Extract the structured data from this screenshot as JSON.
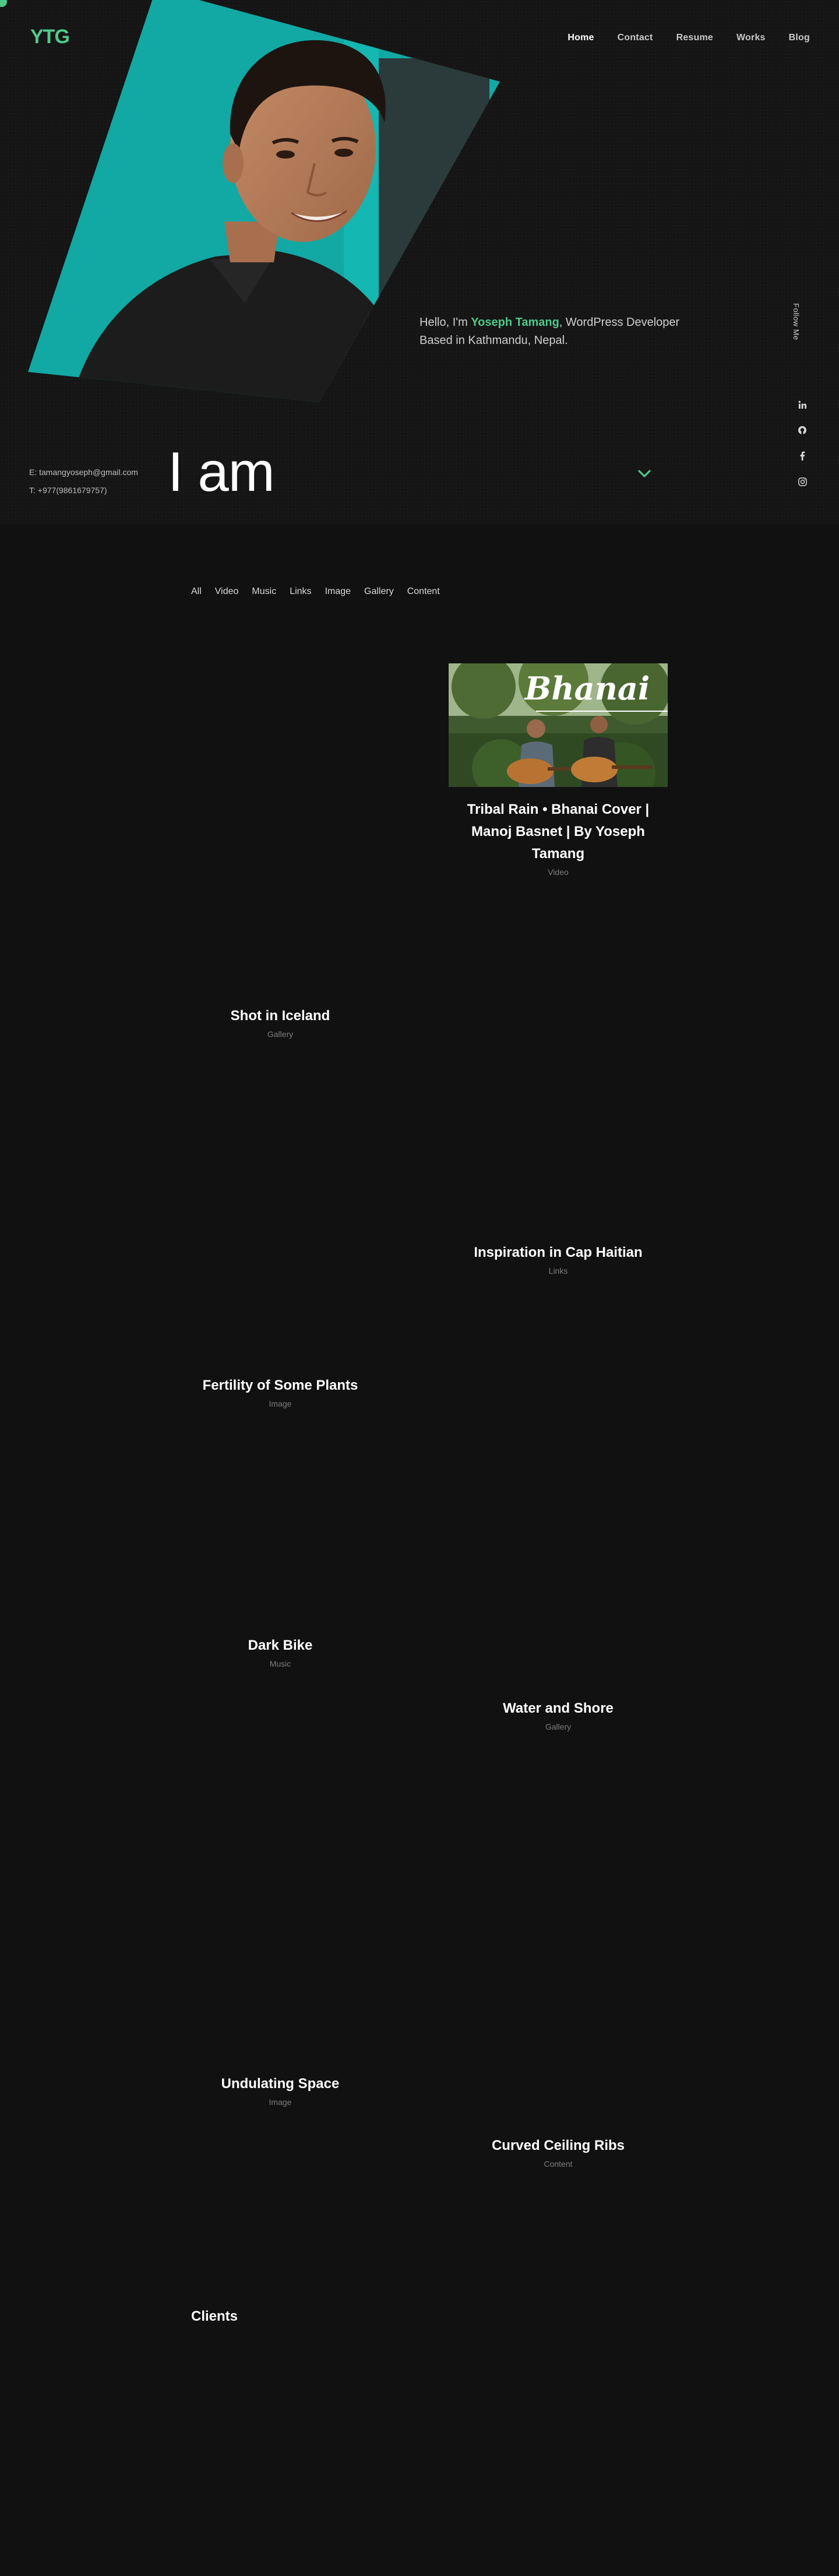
{
  "brand": {
    "logo_text": "YTG"
  },
  "nav": {
    "items": [
      {
        "label": "Home",
        "active": true
      },
      {
        "label": "Contact",
        "active": false
      },
      {
        "label": "Resume",
        "active": false
      },
      {
        "label": "Works",
        "active": false
      },
      {
        "label": "Blog",
        "active": false
      }
    ]
  },
  "hero": {
    "greeting": "Hello, I'm ",
    "name": "Yoseph Tamang",
    "role_line": ", WordPress Developer",
    "location_line": "Based in Kathmandu, Nepal.",
    "headline": "I am",
    "email": "E: tamangyoseph@gmail.com",
    "phone": "T: +977(9861679757)",
    "follow_label": "Follow Me",
    "socials": [
      "linkedin-icon",
      "github-icon",
      "facebook-icon",
      "instagram-icon"
    ]
  },
  "filters": [
    "All",
    "Video",
    "Music",
    "Links",
    "Image",
    "Gallery",
    "Content"
  ],
  "portfolio": [
    {
      "title": "Tribal Rain • Bhanai Cover | Manoj Basnet | By Yoseph Tamang",
      "category": "Video",
      "thumb_text": "Bhanai"
    },
    {
      "title": "Shot in Iceland",
      "category": "Gallery"
    },
    {
      "title": "Inspiration in Cap Haitian",
      "category": "Links"
    },
    {
      "title": "Fertility of Some Plants",
      "category": "Image"
    },
    {
      "title": "Dark Bike",
      "category": "Music"
    },
    {
      "title": "Water and Shore",
      "category": "Gallery"
    },
    {
      "title": "Undulating Space",
      "category": "Image"
    },
    {
      "title": "Curved Ceiling Ribs",
      "category": "Content"
    }
  ],
  "clients": {
    "heading": "Clients"
  },
  "colors": {
    "accent": "#4fc98a",
    "background": "#111111",
    "teal": "#12a8a4"
  }
}
